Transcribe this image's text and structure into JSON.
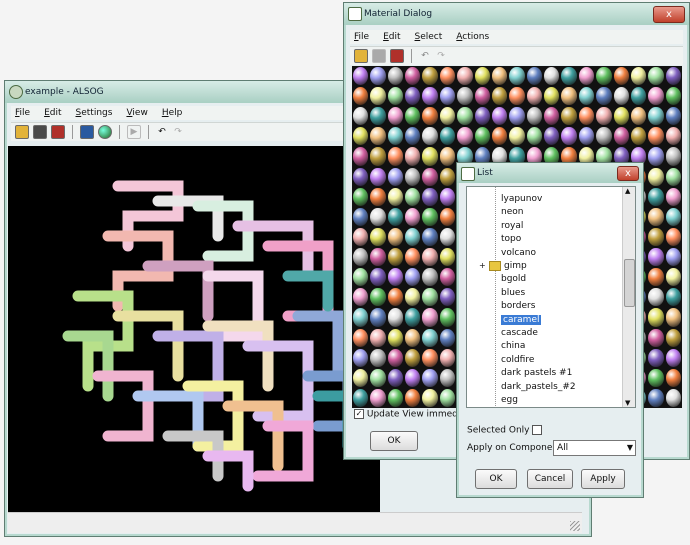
{
  "main_window": {
    "title": "example - ALSOG",
    "menu": [
      "File",
      "Edit",
      "Settings",
      "View",
      "Help"
    ],
    "toolbar_icons": [
      "open-icon",
      "save-icon",
      "saveas-icon",
      "export-icon",
      "material-icon",
      "play-icon",
      "undo-icon",
      "redo-icon"
    ]
  },
  "material_dialog": {
    "title": "Material Dialog",
    "menu": [
      "File",
      "Edit",
      "Select",
      "Actions"
    ],
    "update_checkbox_label": "Update View immedi",
    "ok_label": "OK",
    "close_glyph": "x"
  },
  "list_dialog": {
    "title": "List",
    "items": [
      "lyapunov",
      "neon",
      "royal",
      "topo",
      "volcano",
      "gimp",
      "bgold",
      "blues",
      "borders",
      "caramel",
      "cascade",
      "china",
      "coldfire",
      "dark pastels #1",
      "dark_pastels_#2",
      "egg"
    ],
    "folder_item_index": 5,
    "selected_index": 9,
    "selected_only_label": "Selected Only",
    "apply_component_label": "Apply on Component",
    "apply_component_value": "All",
    "ok_label": "OK",
    "cancel_label": "Cancel",
    "apply_label": "Apply",
    "close_glyph": "x"
  },
  "colors": {
    "title_gradient_top": "#d7ece6",
    "title_gradient_bottom": "#a9cfc3",
    "selection": "#3a7bd5",
    "close_button": "#c0402b"
  }
}
